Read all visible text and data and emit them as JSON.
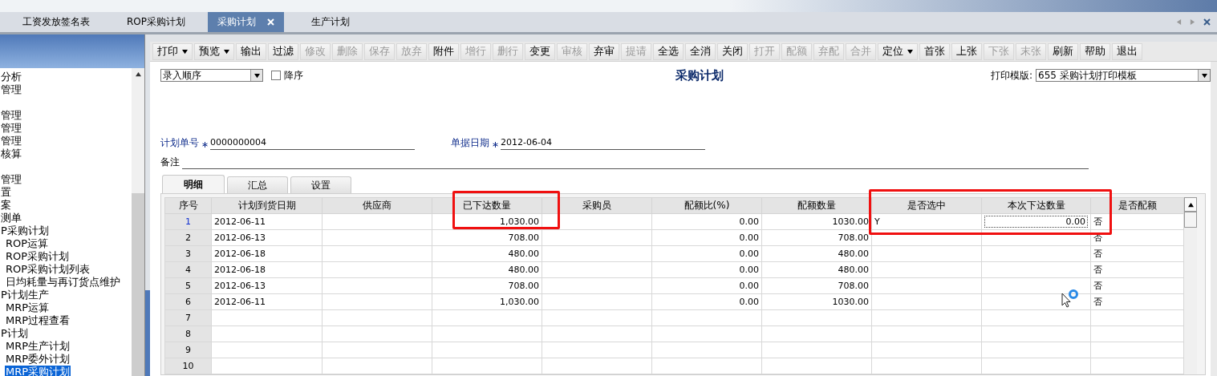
{
  "doc_tabs": [
    {
      "label": "工资发放签名表",
      "selected": false,
      "closable": false
    },
    {
      "label": "ROP采购计划",
      "selected": false,
      "closable": false
    },
    {
      "label": "采购计划",
      "selected": true,
      "closable": true
    },
    {
      "label": "生产计划",
      "selected": false,
      "closable": false
    }
  ],
  "sidebar": {
    "items": [
      {
        "label": "分析",
        "gap_before": false
      },
      {
        "label": "管理",
        "gap_before": false
      },
      {
        "label": "管理",
        "gap_before": true
      },
      {
        "label": "管理",
        "gap_before": false
      },
      {
        "label": "管理",
        "gap_before": false
      },
      {
        "label": "核算",
        "gap_before": false
      },
      {
        "label": "管理",
        "gap_before": true
      },
      {
        "label": "置"
      },
      {
        "label": "案"
      },
      {
        "label": "测单"
      },
      {
        "label": "P采购计划",
        "children": [
          {
            "label": "ROP运算",
            "selected": false
          },
          {
            "label": "ROP采购计划",
            "selected": false
          },
          {
            "label": "ROP采购计划列表",
            "selected": false
          },
          {
            "label": "日均耗量与再订货点维护",
            "selected": false
          }
        ]
      },
      {
        "label": "P计划生产",
        "children": [
          {
            "label": "MRP运算",
            "selected": false
          },
          {
            "label": "MRP过程查看",
            "selected": false
          }
        ]
      },
      {
        "label": "P计划",
        "children": [
          {
            "label": "MRP生产计划",
            "selected": false
          },
          {
            "label": "MRP委外计划",
            "selected": false
          },
          {
            "label": "MRP采购计划",
            "selected": true
          }
        ]
      }
    ]
  },
  "toolbar": [
    {
      "label": "打印",
      "disabled": false,
      "dropdown": true
    },
    {
      "label": "预览",
      "disabled": false,
      "dropdown": true
    },
    {
      "label": "输出",
      "disabled": false,
      "dropdown": false
    },
    {
      "label": "过滤",
      "disabled": false,
      "dropdown": false
    },
    {
      "label": "修改",
      "disabled": true,
      "dropdown": false
    },
    {
      "label": "删除",
      "disabled": true,
      "dropdown": false
    },
    {
      "label": "保存",
      "disabled": true,
      "dropdown": false
    },
    {
      "label": "放弃",
      "disabled": true,
      "dropdown": false
    },
    {
      "label": "附件",
      "disabled": false,
      "dropdown": false
    },
    {
      "label": "增行",
      "disabled": true,
      "dropdown": false
    },
    {
      "label": "删行",
      "disabled": true,
      "dropdown": false
    },
    {
      "label": "变更",
      "disabled": false,
      "dropdown": false
    },
    {
      "label": "审核",
      "disabled": true,
      "dropdown": false
    },
    {
      "label": "弃审",
      "disabled": false,
      "dropdown": false
    },
    {
      "label": "提请",
      "disabled": true,
      "dropdown": false
    },
    {
      "label": "全选",
      "disabled": false,
      "dropdown": false
    },
    {
      "label": "全消",
      "disabled": false,
      "dropdown": false
    },
    {
      "label": "关闭",
      "disabled": false,
      "dropdown": false
    },
    {
      "label": "打开",
      "disabled": true,
      "dropdown": false
    },
    {
      "label": "配额",
      "disabled": true,
      "dropdown": false
    },
    {
      "label": "弃配",
      "disabled": true,
      "dropdown": false
    },
    {
      "label": "合并",
      "disabled": true,
      "dropdown": false
    },
    {
      "label": "定位",
      "disabled": false,
      "dropdown": true
    },
    {
      "label": "首张",
      "disabled": false,
      "dropdown": false
    },
    {
      "label": "上张",
      "disabled": false,
      "dropdown": false
    },
    {
      "label": "下张",
      "disabled": true,
      "dropdown": false
    },
    {
      "label": "末张",
      "disabled": true,
      "dropdown": false
    },
    {
      "label": "刷新",
      "disabled": false,
      "dropdown": false
    },
    {
      "label": "帮助",
      "disabled": false,
      "dropdown": false
    },
    {
      "label": "退出",
      "disabled": false,
      "dropdown": false
    }
  ],
  "form": {
    "sort_order": "录入顺序",
    "descending": {
      "label": "降序",
      "checked": false
    },
    "title": "采购计划",
    "print_template": {
      "label": "打印模版:",
      "value": "655 采购计划打印模板"
    },
    "fields": [
      {
        "label": "计划单号",
        "required": true,
        "value": "0000000004"
      },
      {
        "label": "单据日期",
        "required": true,
        "value": "2012-06-04"
      }
    ],
    "remarks": {
      "label": "备注"
    }
  },
  "detail_tabs": [
    {
      "label": "明细",
      "selected": true
    },
    {
      "label": "汇总",
      "selected": false
    },
    {
      "label": "设置",
      "selected": false
    }
  ],
  "table": {
    "columns": [
      "序号",
      "计划到货日期",
      "供应商",
      "已下达数量",
      "采购员",
      "配额比(%)",
      "配额数量",
      "是否选中",
      "本次下达数量",
      "是否配额"
    ],
    "rows": [
      {
        "selected": true,
        "cells": [
          "1",
          "2012-06-11",
          null,
          "1,030.00",
          null,
          "0.00",
          "1030.00",
          "Y",
          "0.00",
          "否"
        ]
      },
      {
        "selected": false,
        "cells": [
          "2",
          "2012-06-13",
          null,
          "708.00",
          null,
          "0.00",
          "708.00",
          null,
          null,
          "否"
        ]
      },
      {
        "selected": false,
        "cells": [
          "3",
          "2012-06-18",
          null,
          "480.00",
          null,
          "0.00",
          "480.00",
          null,
          null,
          "否"
        ]
      },
      {
        "selected": false,
        "cells": [
          "4",
          "2012-06-18",
          null,
          "480.00",
          null,
          "0.00",
          "480.00",
          null,
          null,
          "否"
        ]
      },
      {
        "selected": false,
        "cells": [
          "5",
          "2012-06-13",
          null,
          "708.00",
          null,
          "0.00",
          "708.00",
          null,
          null,
          "否"
        ]
      },
      {
        "selected": false,
        "cells": [
          "6",
          "2012-06-11",
          null,
          "1,030.00",
          null,
          "0.00",
          "1030.00",
          null,
          null,
          "否"
        ]
      },
      {
        "selected": false,
        "cells": [
          "7"
        ]
      },
      {
        "selected": false,
        "cells": [
          "8"
        ]
      },
      {
        "selected": false,
        "cells": [
          "9"
        ]
      },
      {
        "selected": false,
        "cells": [
          "10"
        ]
      }
    ]
  }
}
